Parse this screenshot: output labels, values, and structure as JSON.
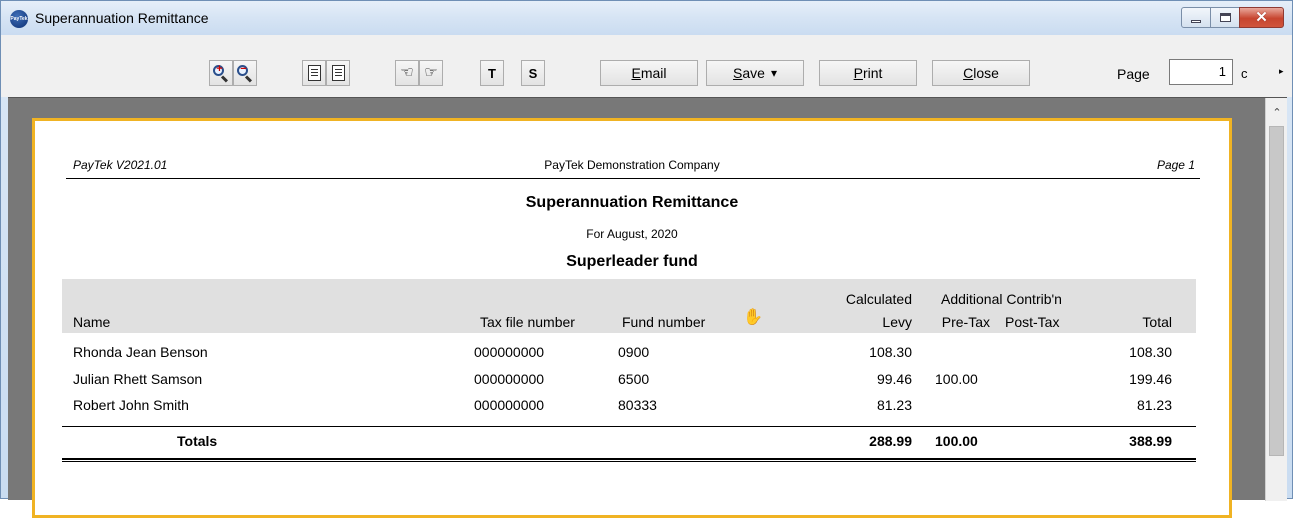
{
  "window": {
    "title": "Superannuation Remittance",
    "app_icon_text": "PayTek",
    "minimize_icon": "minimize-icon",
    "maximize_icon": "maximize-icon",
    "close_icon": "close-icon"
  },
  "toolbar": {
    "zoom_in_icon": "zoom-in-icon",
    "zoom_out_icon": "zoom-out-icon",
    "page_width_icon": "page-width-icon",
    "full_page_icon": "full-page-icon",
    "prev_page_icon": "hand-left-icon",
    "next_page_icon": "hand-right-icon",
    "t_label": "T",
    "s_label": "S",
    "email_accel": "E",
    "email_rest": "mail",
    "save_accel": "S",
    "save_rest": "ave",
    "save_arrow": "▾",
    "print_accel": "P",
    "print_rest": "rint",
    "close_accel": "C",
    "close_rest": "lose",
    "page_label": "Page",
    "page_value": "1",
    "page_of": "c",
    "more_arrow": "▸"
  },
  "report": {
    "version": "PayTek V2021.01",
    "company": "PayTek Demonstration Company",
    "page": "Page 1",
    "title": "Superannuation Remittance",
    "period": "For August, 2020",
    "fund": "Superleader fund",
    "columns": {
      "name": "Name",
      "tfn": "Tax file number",
      "fund_number": "Fund number",
      "calc_top": "Calculated",
      "calc_bottom": "Levy",
      "additional": "Additional Contrib'n",
      "pretax": "Pre-Tax",
      "posttax": "Post-Tax",
      "total": "Total"
    },
    "rows": [
      {
        "name": "Rhonda Jean Benson",
        "tfn": "000000000",
        "fund_number": "0900",
        "levy": "108.30",
        "pretax": "",
        "posttax": "",
        "total": "108.30"
      },
      {
        "name": "Julian Rhett Samson",
        "tfn": "000000000",
        "fund_number": "6500",
        "levy": "99.46",
        "pretax": "100.00",
        "posttax": "",
        "total": "199.46"
      },
      {
        "name": "Robert John Smith",
        "tfn": "000000000",
        "fund_number": "80333",
        "levy": "81.23",
        "pretax": "",
        "posttax": "",
        "total": "81.23"
      }
    ],
    "totals": {
      "label": "Totals",
      "levy": "288.99",
      "pretax": "100.00",
      "total": "388.99"
    }
  },
  "scrollbar": {
    "up_arrow": "⌃"
  },
  "cursor_icon": "hand-cursor-icon",
  "colors": {
    "page_border": "#f0b323",
    "header_band": "#e0e0e0",
    "preview_bg": "#787878"
  }
}
